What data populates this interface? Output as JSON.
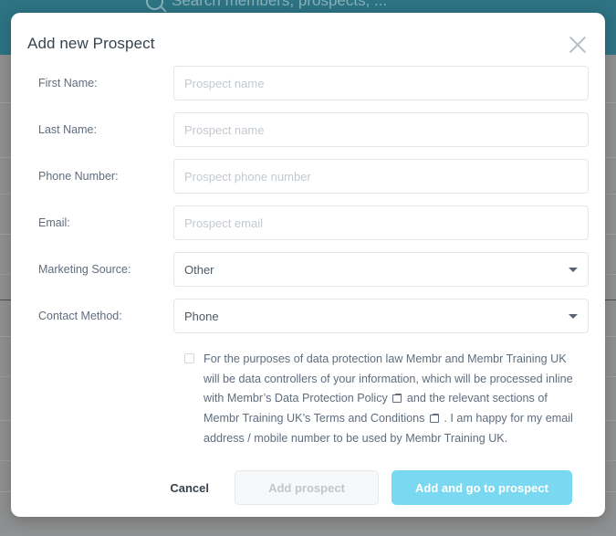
{
  "background": {
    "search_placeholder": "Search members, prospects, ...",
    "search_icon": "search-icon",
    "topbar_color": "#2d7383",
    "overlay_color": "#8f9091"
  },
  "modal": {
    "title": "Add new Prospect",
    "close_icon": "close-icon",
    "fields": [
      {
        "label": "First Name:",
        "type": "text",
        "value": "",
        "placeholder": "Prospect name"
      },
      {
        "label": "Last Name:",
        "type": "text",
        "value": "",
        "placeholder": "Prospect name"
      },
      {
        "label": "Phone Number:",
        "type": "text",
        "value": "",
        "placeholder": "Prospect phone number"
      },
      {
        "label": "Email:",
        "type": "text",
        "value": "",
        "placeholder": "Prospect email"
      },
      {
        "label": "Marketing Source:",
        "type": "select",
        "value": "Other",
        "placeholder": ""
      },
      {
        "label": "Contact Method:",
        "type": "select",
        "value": "Phone",
        "placeholder": ""
      }
    ],
    "consent": {
      "checked": false,
      "text_part_1": "For the purposes of data protection law Membr and Membr Training UK will be data controllers of your information, which will be processed inline with Membr’s Data Protection Policy",
      "link_icon_1": "external-link-icon",
      "text_part_2": " and the relevant sections of Membr Training UK’s Terms and Conditions",
      "link_icon_2": "external-link-icon",
      "text_part_3": ". I am happy for my email address / mobile number to be used by Membr Training UK."
    },
    "footer": {
      "cancel_label": "Cancel",
      "add_label": "Add prospect",
      "add_and_go_label": "Add and go to prospect",
      "primary_color": "#7ad9f0",
      "disabled_color": "#f7f8fa"
    }
  }
}
